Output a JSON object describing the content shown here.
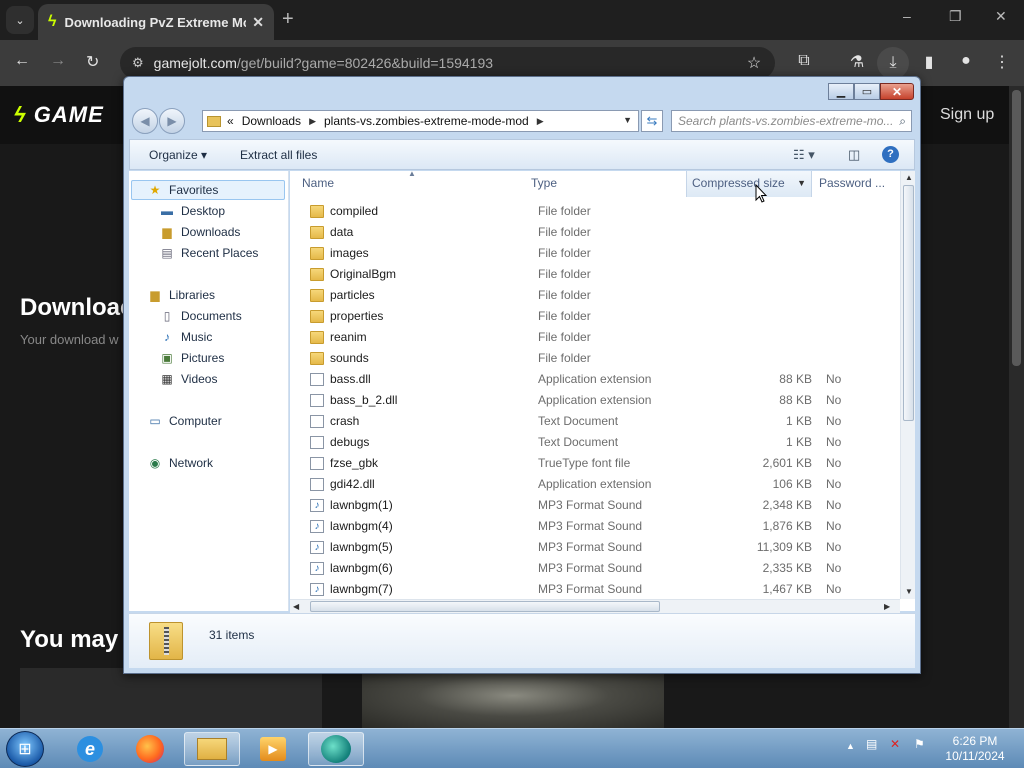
{
  "browser": {
    "tab_title": "Downloading PvZ Extreme Mo",
    "tab_favicon": "gamejolt-bolt-icon",
    "url_host": "gamejolt.com",
    "url_path": "/get/build?game=802426&build=1594193",
    "window_controls": [
      "–",
      "❐",
      "✕"
    ]
  },
  "page": {
    "logo_text": "GAME",
    "signup": "Sign up",
    "heading": "Downloac",
    "subtext": "Your download w",
    "heading2": "You may a"
  },
  "explorer": {
    "address": {
      "chevrons": "«",
      "crumbs": [
        "Downloads",
        "plants-vs.zombies-extreme-mode-mod"
      ]
    },
    "search_placeholder": "Search plants-vs.zombies-extreme-mo...",
    "commands": {
      "organize": "Organize",
      "extract": "Extract all files"
    },
    "nav": {
      "favorites": "Favorites",
      "desktop": "Desktop",
      "downloads": "Downloads",
      "recent": "Recent Places",
      "libraries": "Libraries",
      "documents": "Documents",
      "music": "Music",
      "pictures": "Pictures",
      "videos": "Videos",
      "computer": "Computer",
      "network": "Network"
    },
    "columns": {
      "name": "Name",
      "type": "Type",
      "size": "Compressed size",
      "password": "Password ..."
    },
    "files": [
      {
        "name": "compiled",
        "type": "File folder",
        "size": "",
        "pw": "",
        "kind": "folder"
      },
      {
        "name": "data",
        "type": "File folder",
        "size": "",
        "pw": "",
        "kind": "folder"
      },
      {
        "name": "images",
        "type": "File folder",
        "size": "",
        "pw": "",
        "kind": "folder"
      },
      {
        "name": "OriginalBgm",
        "type": "File folder",
        "size": "",
        "pw": "",
        "kind": "folder"
      },
      {
        "name": "particles",
        "type": "File folder",
        "size": "",
        "pw": "",
        "kind": "folder"
      },
      {
        "name": "properties",
        "type": "File folder",
        "size": "",
        "pw": "",
        "kind": "folder"
      },
      {
        "name": "reanim",
        "type": "File folder",
        "size": "",
        "pw": "",
        "kind": "folder"
      },
      {
        "name": "sounds",
        "type": "File folder",
        "size": "",
        "pw": "",
        "kind": "folder"
      },
      {
        "name": "bass.dll",
        "type": "Application extension",
        "size": "88 KB",
        "pw": "No",
        "kind": "dll"
      },
      {
        "name": "bass_b_2.dll",
        "type": "Application extension",
        "size": "88 KB",
        "pw": "No",
        "kind": "dll"
      },
      {
        "name": "crash",
        "type": "Text Document",
        "size": "1 KB",
        "pw": "No",
        "kind": "txt"
      },
      {
        "name": "debugs",
        "type": "Text Document",
        "size": "1 KB",
        "pw": "No",
        "kind": "txt"
      },
      {
        "name": "fzse_gbk",
        "type": "TrueType font file",
        "size": "2,601 KB",
        "pw": "No",
        "kind": "font"
      },
      {
        "name": "gdi42.dll",
        "type": "Application extension",
        "size": "106 KB",
        "pw": "No",
        "kind": "dll"
      },
      {
        "name": "lawnbgm(1)",
        "type": "MP3 Format Sound",
        "size": "2,348 KB",
        "pw": "No",
        "kind": "mp3"
      },
      {
        "name": "lawnbgm(4)",
        "type": "MP3 Format Sound",
        "size": "1,876 KB",
        "pw": "No",
        "kind": "mp3"
      },
      {
        "name": "lawnbgm(5)",
        "type": "MP3 Format Sound",
        "size": "11,309 KB",
        "pw": "No",
        "kind": "mp3"
      },
      {
        "name": "lawnbgm(6)",
        "type": "MP3 Format Sound",
        "size": "2,335 KB",
        "pw": "No",
        "kind": "mp3"
      },
      {
        "name": "lawnbgm(7)",
        "type": "MP3 Format Sound",
        "size": "1,467 KB",
        "pw": "No",
        "kind": "mp3"
      }
    ],
    "status": "31 items"
  },
  "taskbar": {
    "time": "6:26 PM",
    "date": "10/11/2024"
  }
}
